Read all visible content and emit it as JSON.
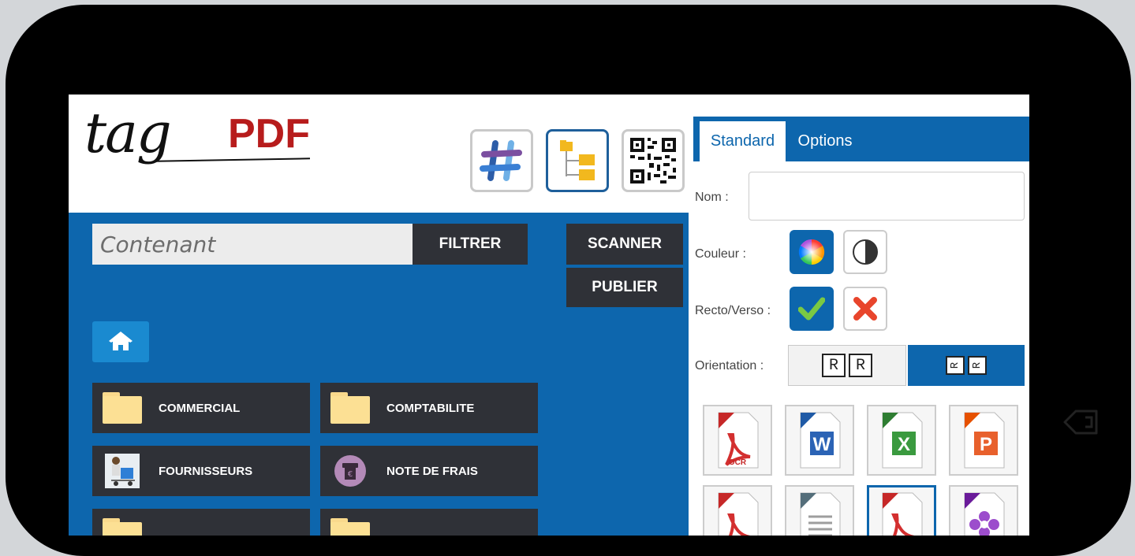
{
  "logo": {
    "script_text": "tag",
    "pdf_text": "PDF"
  },
  "toolbar": {
    "tools": [
      {
        "icon": "hashtag-icon"
      },
      {
        "icon": "folder-tree-icon",
        "active": true
      },
      {
        "icon": "qr-code-icon"
      }
    ]
  },
  "search": {
    "placeholder": "Contenant",
    "value": ""
  },
  "buttons": {
    "filter": "FILTRER",
    "scan": "SCANNER",
    "publish": "PUBLIER"
  },
  "home": {
    "icon": "home-icon"
  },
  "folders": [
    {
      "label": "COMMERCIAL",
      "icon": "folder-icon"
    },
    {
      "label": "COMPTABILITE",
      "icon": "folder-icon"
    },
    {
      "label": "FOURNISSEURS",
      "icon": "delivery-icon"
    },
    {
      "label": "NOTE DE FRAIS",
      "icon": "receipt-icon"
    }
  ],
  "panel": {
    "tabs": [
      "Standard",
      "Options"
    ],
    "active_tab": "Standard",
    "nom_label": "Nom :",
    "nom_value": "",
    "couleur_label": "Couleur :",
    "recto_label": "Recto/Verso :",
    "orientation_label": "Orientation :",
    "orientation_a": [
      "R",
      "R"
    ],
    "orientation_b": [
      "R",
      "R"
    ],
    "formats": [
      {
        "icon": "pdf-ocr-icon",
        "caption": "OCR"
      },
      {
        "icon": "word-docx-icon",
        "caption": ""
      },
      {
        "icon": "excel-xlsx-icon",
        "caption": ""
      },
      {
        "icon": "powerpoint-pptx-icon",
        "caption": ""
      },
      {
        "icon": "pdf-a-icon",
        "caption": ""
      },
      {
        "icon": "text-file-icon",
        "caption": ""
      },
      {
        "icon": "pdf-icon",
        "caption": "",
        "selected": true
      },
      {
        "icon": "tiff-icon",
        "caption": ""
      }
    ]
  },
  "colors": {
    "brand_blue": "#0d66ad",
    "dark_button": "#2f3137",
    "pdf_red": "#b71c1c"
  }
}
